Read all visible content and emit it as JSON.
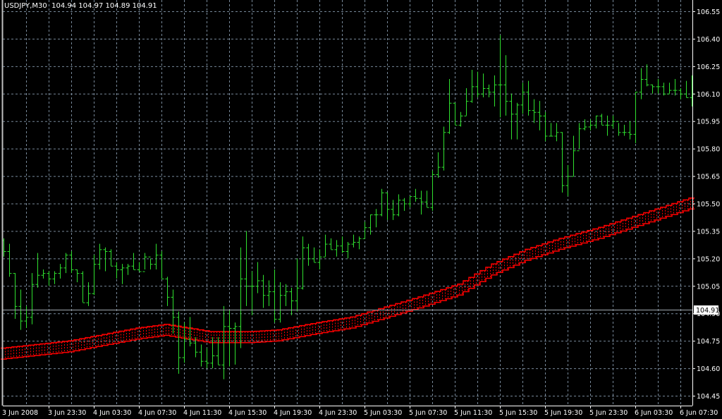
{
  "header": {
    "symbol": "USDJPY,M30",
    "ohlc": "104.94 104.97 104.89 104.91"
  },
  "colors": {
    "background": "#000000",
    "grid": "#778899",
    "bars": "#2fe02f",
    "envelope": "#ff0000",
    "axis": "#ffffff",
    "price_line": "#a0a8b0"
  },
  "chart_data": {
    "type": "ohlc-bar",
    "title": "USDJPY,M30",
    "timeframe": "M30",
    "first_open": 105.3,
    "high": [
      105.31,
      105.28,
      105.12,
      105.03,
      104.94,
      105.12,
      105.23,
      105.14,
      105.13,
      105.13,
      105.17,
      105.23,
      105.24,
      105.14,
      105.13,
      105.07,
      105.22,
      105.28,
      105.26,
      105.25,
      105.18,
      105.17,
      105.17,
      105.23,
      105.18,
      105.23,
      105.2,
      105.28,
      105.24,
      105.1,
      105.03,
      104.91,
      104.85,
      104.88,
      104.77,
      104.73,
      104.71,
      104.77,
      104.77,
      104.94,
      104.92,
      104.85,
      105.26,
      105.35,
      105.13,
      105.18,
      105.11,
      105.08,
      105.14,
      105.07,
      105.06,
      105.04,
      105.2,
      105.32,
      105.28,
      105.26,
      105.25,
      105.33,
      105.31,
      105.3,
      105.32,
      105.29,
      105.33,
      105.32,
      105.4,
      105.44,
      105.47,
      105.58,
      105.56,
      105.52,
      105.55,
      105.53,
      105.54,
      105.58,
      105.57,
      105.57,
      105.68,
      105.78,
      105.92,
      106.18,
      106.05,
      106.0,
      106.13,
      106.23,
      106.22,
      106.21,
      106.15,
      106.2,
      106.42,
      106.31,
      106.1,
      106.05,
      106.16,
      106.17,
      106.07,
      106.06,
      106.0,
      105.94,
      105.94,
      105.89,
      105.71,
      105.87,
      105.94,
      105.96,
      105.96,
      105.98,
      105.99,
      105.98,
      105.98,
      105.94,
      105.93,
      105.95,
      106.11,
      106.24,
      106.26,
      106.15,
      106.18,
      106.16,
      106.16,
      106.18,
      106.13,
      106.17,
      106.2
    ],
    "low": [
      105.21,
      105.1,
      104.87,
      104.81,
      104.82,
      104.84,
      105.04,
      105.09,
      105.05,
      105.06,
      105.09,
      105.12,
      105.12,
      105.07,
      104.96,
      104.94,
      105.0,
      105.14,
      105.13,
      105.16,
      105.09,
      105.06,
      105.11,
      105.14,
      105.13,
      105.14,
      105.14,
      105.14,
      105.09,
      104.94,
      104.79,
      104.57,
      104.63,
      104.72,
      104.66,
      104.61,
      104.6,
      104.6,
      104.62,
      104.54,
      104.61,
      104.62,
      104.71,
      104.94,
      104.89,
      105.01,
      104.93,
      104.94,
      104.85,
      104.85,
      104.94,
      104.89,
      104.91,
      105.03,
      105.16,
      105.18,
      105.14,
      105.21,
      105.25,
      105.21,
      105.23,
      105.2,
      105.26,
      105.25,
      105.31,
      105.33,
      105.37,
      105.43,
      105.41,
      105.41,
      105.43,
      105.46,
      105.48,
      105.51,
      105.44,
      105.48,
      105.46,
      105.64,
      105.68,
      105.88,
      105.93,
      105.92,
      105.98,
      106.05,
      106.08,
      106.08,
      106.08,
      106.03,
      105.97,
      105.98,
      105.85,
      105.85,
      105.99,
      105.98,
      105.94,
      105.9,
      105.84,
      105.87,
      105.84,
      105.56,
      105.54,
      105.65,
      105.8,
      105.9,
      105.9,
      105.91,
      105.93,
      105.87,
      105.91,
      105.87,
      105.87,
      105.85,
      105.83,
      106.07,
      106.14,
      106.1,
      106.1,
      106.09,
      106.1,
      106.09,
      106.07,
      106.08,
      106.03
    ],
    "close": [
      105.24,
      105.12,
      104.94,
      104.86,
      104.88,
      105.06,
      105.11,
      105.12,
      105.09,
      105.12,
      105.15,
      105.22,
      105.14,
      105.12,
      104.96,
      105.01,
      105.17,
      105.25,
      105.24,
      105.16,
      105.14,
      105.15,
      105.16,
      105.14,
      105.13,
      105.21,
      105.17,
      105.22,
      105.09,
      104.99,
      104.88,
      104.66,
      104.76,
      104.74,
      104.69,
      104.64,
      104.63,
      104.67,
      104.62,
      104.83,
      104.82,
      104.83,
      105.09,
      105.05,
      105.05,
      105.08,
      105.0,
      105.02,
      104.87,
      105.0,
      105.02,
      104.97,
      105.04,
      105.26,
      105.2,
      105.18,
      105.21,
      105.28,
      105.25,
      105.27,
      105.24,
      105.28,
      105.29,
      105.31,
      105.37,
      105.44,
      105.44,
      105.56,
      105.47,
      105.44,
      105.52,
      105.5,
      105.54,
      105.53,
      105.51,
      105.48,
      105.66,
      105.7,
      105.89,
      106.05,
      105.93,
      105.98,
      106.06,
      106.14,
      106.1,
      106.13,
      106.11,
      106.15,
      106.15,
      106.06,
      105.99,
      106.04,
      106.11,
      106.01,
      106.0,
      105.98,
      105.87,
      105.87,
      105.89,
      105.6,
      105.65,
      105.79,
      105.91,
      105.92,
      105.93,
      105.98,
      105.93,
      105.93,
      105.95,
      105.89,
      105.89,
      105.88,
      106.11,
      106.18,
      106.15,
      106.14,
      106.14,
      106.1,
      106.12,
      106.12,
      106.1,
      106.08,
      106.1
    ],
    "envelope": {
      "name": "Moving average envelope",
      "half_width": 0.03,
      "center_anchors": [
        [
          0,
          104.68
        ],
        [
          12,
          104.72
        ],
        [
          24,
          104.79
        ],
        [
          29,
          104.81
        ],
        [
          37,
          104.77
        ],
        [
          44,
          104.77
        ],
        [
          49,
          104.78
        ],
        [
          56,
          104.82
        ],
        [
          62,
          104.85
        ],
        [
          74,
          104.96
        ],
        [
          81,
          105.03
        ],
        [
          87,
          105.14
        ],
        [
          93,
          105.22
        ],
        [
          99,
          105.28
        ],
        [
          106,
          105.34
        ],
        [
          112,
          105.4
        ],
        [
          122,
          105.5
        ]
      ]
    },
    "current_price": 104.91,
    "current_price_label": "104.91",
    "ylim": [
      104.4,
      106.6
    ],
    "y_ticks": [
      "106.55",
      "106.40",
      "106.25",
      "106.10",
      "105.95",
      "105.80",
      "105.65",
      "105.50",
      "105.35",
      "105.20",
      "105.05",
      "104.90",
      "104.75",
      "104.60",
      "104.45"
    ],
    "y_tick_values": [
      106.55,
      106.4,
      106.25,
      106.1,
      105.95,
      105.8,
      105.65,
      105.5,
      105.35,
      105.2,
      105.05,
      104.9,
      104.75,
      104.6,
      104.45
    ],
    "x_ticks": [
      "3 Jun 2008",
      "3 Jun 23:30",
      "4 Jun 03:30",
      "4 Jun 07:30",
      "4 Jun 11:30",
      "4 Jun 15:30",
      "4 Jun 19:30",
      "4 Jun 23:30",
      "5 Jun 03:30",
      "5 Jun 07:30",
      "5 Jun 11:30",
      "5 Jun 15:30",
      "5 Jun 19:30",
      "5 Jun 23:30",
      "6 Jun 03:30",
      "6 Jun 07:30"
    ],
    "grid": true
  }
}
